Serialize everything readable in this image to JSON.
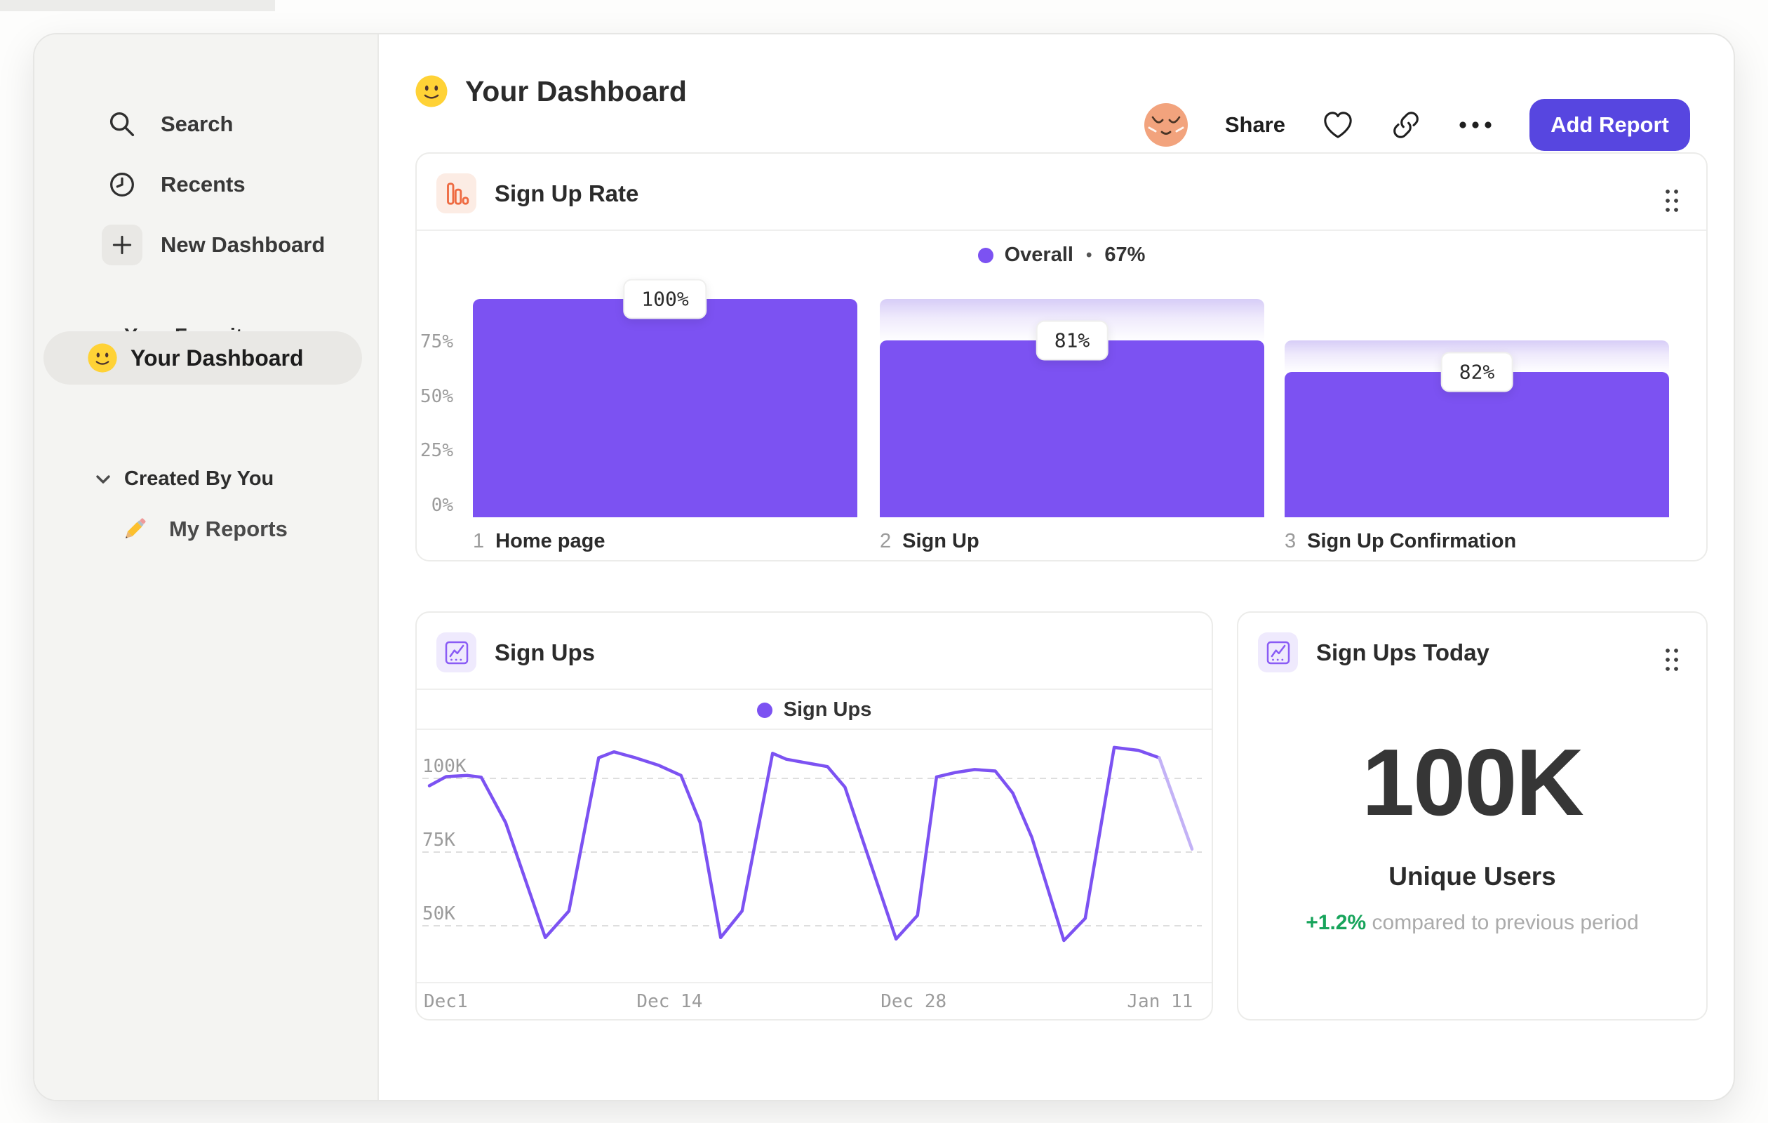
{
  "header": {
    "title": "Your Dashboard",
    "share_label": "Share",
    "add_report_label": "Add Report"
  },
  "sidebar": {
    "search_label": "Search",
    "recents_label": "Recents",
    "new_dashboard_label": "New Dashboard",
    "favorites_section": "Your Favorites",
    "favorite_item": "Your Dashboard",
    "created_section": "Created By You",
    "created_item": "My Reports"
  },
  "icons": {
    "sidebar": [
      "search-icon",
      "clock-icon",
      "plus-icon",
      "chevron-down-icon",
      "smiley-emoji-icon",
      "pencil-emoji-icon"
    ],
    "header": [
      "avatar",
      "heart-icon",
      "link-icon",
      "ellipsis-icon"
    ],
    "cards": [
      "bar-chart-icon",
      "line-chart-icon",
      "drag-handle-icon"
    ]
  },
  "colors": {
    "accent_purple": "#7C52F2",
    "accent_purple_faded": "#C3B2F6",
    "funnel_gradient_top": "#D7CDF7",
    "button_indigo": "#5746E0",
    "green": "#17A45B",
    "orange": "#EE6A41",
    "axis_gray": "#9B9B9B"
  },
  "chart_data": [
    {
      "id": "signup_rate",
      "type": "funnel_bar",
      "title": "Sign Up Rate",
      "legend": {
        "label": "Overall",
        "separator": "•",
        "value_display": "67%",
        "value_pct": 67
      },
      "ylim": [
        0,
        100
      ],
      "grid": false,
      "y_ticks": [
        {
          "label": "75%",
          "value": 75
        },
        {
          "label": "50%",
          "value": 50
        },
        {
          "label": "25%",
          "value": 25
        },
        {
          "label": "0%",
          "value": 0
        }
      ],
      "steps": [
        {
          "index": "1",
          "label": "Home page",
          "step_rate_pct": 100,
          "badge": "100%",
          "absolute_pct": 100
        },
        {
          "index": "2",
          "label": "Sign Up",
          "step_rate_pct": 81,
          "badge": "81%",
          "absolute_pct": 81
        },
        {
          "index": "3",
          "label": "Sign Up Confirmation",
          "step_rate_pct": 82,
          "badge": "82%",
          "absolute_pct": 66.4
        }
      ]
    },
    {
      "id": "signups",
      "type": "line",
      "title": "Sign Ups",
      "legend": "Sign Ups",
      "ylabel": "",
      "unit": "K",
      "ylim": [
        38,
        116
      ],
      "grid": "dashed-horizontal",
      "legend_position": "top-center",
      "y_ticks": [
        {
          "label": "100K",
          "value": 100
        },
        {
          "label": "75K",
          "value": 75
        },
        {
          "label": "50K",
          "value": 50
        }
      ],
      "x_ticks": [
        {
          "label": "Dec1",
          "frac": 0.0,
          "align": "left"
        },
        {
          "label": "Dec 14",
          "frac": 0.315,
          "align": "center"
        },
        {
          "label": "Dec 28",
          "frac": 0.635,
          "align": "center"
        },
        {
          "label": "Jan 11",
          "frac": 0.958,
          "align": "center"
        }
      ],
      "points": [
        [
          0.0,
          97.5
        ],
        [
          0.022,
          100.6
        ],
        [
          0.05,
          101.0
        ],
        [
          0.068,
          100.4
        ],
        [
          0.1,
          85.0
        ],
        [
          0.152,
          46.0
        ],
        [
          0.183,
          55.0
        ],
        [
          0.222,
          107.0
        ],
        [
          0.242,
          109.0
        ],
        [
          0.27,
          107.0
        ],
        [
          0.3,
          104.5
        ],
        [
          0.33,
          101.0
        ],
        [
          0.355,
          85.0
        ],
        [
          0.382,
          46.0
        ],
        [
          0.41,
          55.0
        ],
        [
          0.45,
          108.5
        ],
        [
          0.468,
          106.5
        ],
        [
          0.5,
          105.0
        ],
        [
          0.522,
          104.0
        ],
        [
          0.545,
          97.0
        ],
        [
          0.567,
          80.0
        ],
        [
          0.612,
          45.5
        ],
        [
          0.64,
          53.5
        ],
        [
          0.665,
          100.5
        ],
        [
          0.69,
          102.0
        ],
        [
          0.715,
          103.0
        ],
        [
          0.742,
          102.5
        ],
        [
          0.765,
          95.0
        ],
        [
          0.79,
          80.0
        ],
        [
          0.832,
          45.0
        ],
        [
          0.86,
          52.5
        ],
        [
          0.898,
          110.5
        ],
        [
          0.93,
          109.5
        ],
        [
          0.957,
          107.0
        ],
        [
          1.0,
          76.0
        ]
      ],
      "last_segment_partial": true
    },
    {
      "id": "signups_today",
      "type": "big_number",
      "title": "Sign Ups Today",
      "value": "100K",
      "label": "Unique Users",
      "delta": "+1.2%",
      "delta_description": "compared to previous period"
    }
  ]
}
